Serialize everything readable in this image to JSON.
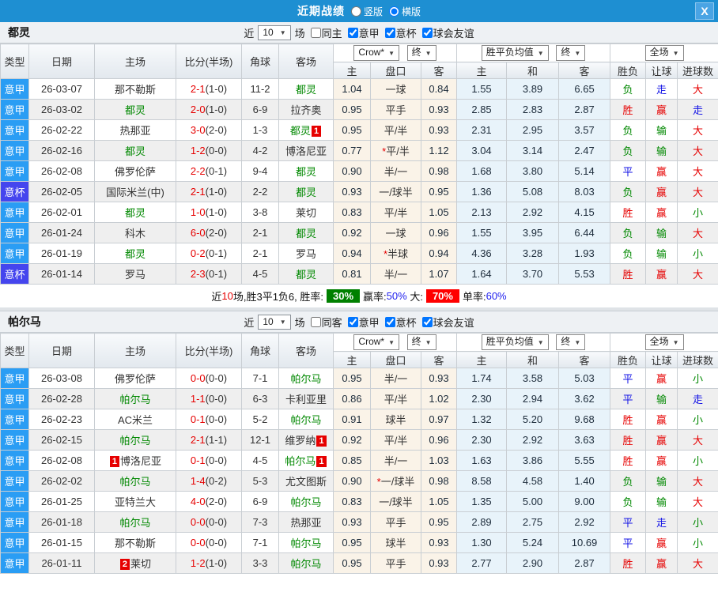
{
  "titlebar": {
    "title": "近期战绩",
    "close": "X",
    "layout": {
      "vertical": {
        "label": "竖版",
        "checked": false
      },
      "horizontal": {
        "label": "横版",
        "checked": true
      }
    }
  },
  "columns": {
    "type": "类型",
    "date": "日期",
    "home": "主场",
    "score": "比分(半场)",
    "corner": "角球",
    "away": "客场",
    "odds_home": "主",
    "handicap": "盘口",
    "odds_away": "客",
    "mean_home": "主",
    "mean_draw": "和",
    "mean_away": "客",
    "result": "胜负",
    "let_goal": "让球",
    "goals": "进球数"
  },
  "dropdowns": {
    "company": "Crow*",
    "final": "终",
    "mean": "胜平负均值",
    "full": "全场",
    "arrow": "▼"
  },
  "colors": {
    "header_blue": "#1e8fd2",
    "serie_a_badge": "#2a9df4",
    "italy_cup_badge": "#4545ee",
    "win_red": "#e60000",
    "loss_green": "#008800",
    "draw_blue": "#1414e6",
    "odds_bg": "#faf3e8",
    "mean_bg": "#e8f3fa"
  },
  "sections": [
    {
      "team": "都灵",
      "filter": {
        "near": "近",
        "count": "10",
        "games": "场",
        "same_label": "同主",
        "same_checked": false,
        "leagues": [
          {
            "label": "意甲",
            "checked": true
          },
          {
            "label": "意杯",
            "checked": true
          },
          {
            "label": "球会友谊",
            "checked": true
          }
        ]
      },
      "rows": [
        {
          "lt": "jia",
          "league": "意甲",
          "date": "26-03-07",
          "home": {
            "t": "那不勒斯"
          },
          "score": "2-1",
          "half": "(1-0)",
          "corner": "11-2",
          "away": {
            "t": "都灵",
            "g": 1
          },
          "o": [
            "1.04",
            "一球",
            "0.84"
          ],
          "star": 0,
          "m": [
            "1.55",
            "3.89",
            "6.65"
          ],
          "res": [
            [
              "负",
              "g"
            ],
            [
              "走",
              "b"
            ],
            [
              "大",
              "r"
            ]
          ]
        },
        {
          "lt": "jia",
          "league": "意甲",
          "date": "26-03-02",
          "home": {
            "t": "都灵",
            "g": 1
          },
          "score": "2-0",
          "half": "(1-0)",
          "corner": "6-9",
          "away": {
            "t": "拉齐奥"
          },
          "o": [
            "0.95",
            "平手",
            "0.93"
          ],
          "star": 0,
          "m": [
            "2.85",
            "2.83",
            "2.87"
          ],
          "res": [
            [
              "胜",
              "r"
            ],
            [
              "赢",
              "r"
            ],
            [
              "走",
              "b"
            ]
          ]
        },
        {
          "lt": "jia",
          "league": "意甲",
          "date": "26-02-22",
          "home": {
            "t": "热那亚"
          },
          "score": "3-0",
          "half": "(2-0)",
          "corner": "1-3",
          "away": {
            "t": "都灵",
            "g": 1,
            "bd": "1",
            "bp": "after"
          },
          "o": [
            "0.95",
            "平/半",
            "0.93"
          ],
          "star": 0,
          "m": [
            "2.31",
            "2.95",
            "3.57"
          ],
          "res": [
            [
              "负",
              "g"
            ],
            [
              "输",
              "g"
            ],
            [
              "大",
              "r"
            ]
          ]
        },
        {
          "lt": "jia",
          "league": "意甲",
          "date": "26-02-16",
          "home": {
            "t": "都灵",
            "g": 1
          },
          "score": "1-2",
          "half": "(0-0)",
          "corner": "4-2",
          "away": {
            "t": "博洛尼亚"
          },
          "o": [
            "0.77",
            "平/半",
            "1.12"
          ],
          "star": 1,
          "m": [
            "3.04",
            "3.14",
            "2.47"
          ],
          "res": [
            [
              "负",
              "g"
            ],
            [
              "输",
              "g"
            ],
            [
              "大",
              "r"
            ]
          ]
        },
        {
          "lt": "jia",
          "league": "意甲",
          "date": "26-02-08",
          "home": {
            "t": "佛罗伦萨"
          },
          "score": "2-2",
          "half": "(0-1)",
          "corner": "9-4",
          "away": {
            "t": "都灵",
            "g": 1
          },
          "o": [
            "0.90",
            "半/一",
            "0.98"
          ],
          "star": 0,
          "m": [
            "1.68",
            "3.80",
            "5.14"
          ],
          "res": [
            [
              "平",
              "b"
            ],
            [
              "赢",
              "r"
            ],
            [
              "大",
              "r"
            ]
          ]
        },
        {
          "lt": "bei",
          "league": "意杯",
          "date": "26-02-05",
          "home": {
            "t": "国际米兰(中)"
          },
          "score": "2-1",
          "half": "(1-0)",
          "corner": "2-2",
          "away": {
            "t": "都灵",
            "g": 1
          },
          "o": [
            "0.93",
            "一/球半",
            "0.95"
          ],
          "star": 0,
          "m": [
            "1.36",
            "5.08",
            "8.03"
          ],
          "res": [
            [
              "负",
              "g"
            ],
            [
              "赢",
              "r"
            ],
            [
              "大",
              "r"
            ]
          ]
        },
        {
          "lt": "jia",
          "league": "意甲",
          "date": "26-02-01",
          "home": {
            "t": "都灵",
            "g": 1
          },
          "score": "1-0",
          "half": "(1-0)",
          "corner": "3-8",
          "away": {
            "t": "莱切"
          },
          "o": [
            "0.83",
            "平/半",
            "1.05"
          ],
          "star": 0,
          "m": [
            "2.13",
            "2.92",
            "4.15"
          ],
          "res": [
            [
              "胜",
              "r"
            ],
            [
              "赢",
              "r"
            ],
            [
              "小",
              "g"
            ]
          ]
        },
        {
          "lt": "jia",
          "league": "意甲",
          "date": "26-01-24",
          "home": {
            "t": "科木"
          },
          "score": "6-0",
          "half": "(2-0)",
          "corner": "2-1",
          "away": {
            "t": "都灵",
            "g": 1
          },
          "o": [
            "0.92",
            "一球",
            "0.96"
          ],
          "star": 0,
          "m": [
            "1.55",
            "3.95",
            "6.44"
          ],
          "res": [
            [
              "负",
              "g"
            ],
            [
              "输",
              "g"
            ],
            [
              "大",
              "r"
            ]
          ]
        },
        {
          "lt": "jia",
          "league": "意甲",
          "date": "26-01-19",
          "home": {
            "t": "都灵",
            "g": 1
          },
          "score": "0-2",
          "half": "(0-1)",
          "corner": "2-1",
          "away": {
            "t": "罗马"
          },
          "o": [
            "0.94",
            "半球",
            "0.94"
          ],
          "star": 1,
          "m": [
            "4.36",
            "3.28",
            "1.93"
          ],
          "res": [
            [
              "负",
              "g"
            ],
            [
              "输",
              "g"
            ],
            [
              "小",
              "g"
            ]
          ]
        },
        {
          "lt": "bei",
          "league": "意杯",
          "date": "26-01-14",
          "home": {
            "t": "罗马"
          },
          "score": "2-3",
          "half": "(0-1)",
          "corner": "4-5",
          "away": {
            "t": "都灵",
            "g": 1
          },
          "o": [
            "0.81",
            "半/一",
            "1.07"
          ],
          "star": 0,
          "m": [
            "1.64",
            "3.70",
            "5.53"
          ],
          "res": [
            [
              "胜",
              "r"
            ],
            [
              "赢",
              "r"
            ],
            [
              "大",
              "r"
            ]
          ]
        }
      ],
      "summary": {
        "p1": "近",
        "count": "10",
        "p2": "场,胜3平1负6, 胜率:",
        "win_rate": "30%",
        "p3": "赢率:",
        "v2": "50%",
        "p4": "大:",
        "v3": "70%",
        "p5": "单率:",
        "v4": "60%"
      }
    },
    {
      "team": "帕尔马",
      "filter": {
        "near": "近",
        "count": "10",
        "games": "场",
        "same_label": "同客",
        "same_checked": false,
        "leagues": [
          {
            "label": "意甲",
            "checked": true
          },
          {
            "label": "意杯",
            "checked": true
          },
          {
            "label": "球会友谊",
            "checked": true
          }
        ]
      },
      "rows": [
        {
          "lt": "jia",
          "league": "意甲",
          "date": "26-03-08",
          "home": {
            "t": "佛罗伦萨"
          },
          "score": "0-0",
          "half": "(0-0)",
          "corner": "7-1",
          "away": {
            "t": "帕尔马",
            "g": 1
          },
          "o": [
            "0.95",
            "半/一",
            "0.93"
          ],
          "star": 0,
          "m": [
            "1.74",
            "3.58",
            "5.03"
          ],
          "res": [
            [
              "平",
              "b"
            ],
            [
              "赢",
              "r"
            ],
            [
              "小",
              "g"
            ]
          ]
        },
        {
          "lt": "jia",
          "league": "意甲",
          "date": "26-02-28",
          "home": {
            "t": "帕尔马",
            "g": 1
          },
          "score": "1-1",
          "half": "(0-0)",
          "corner": "6-3",
          "away": {
            "t": "卡利亚里"
          },
          "o": [
            "0.86",
            "平/半",
            "1.02"
          ],
          "star": 0,
          "m": [
            "2.30",
            "2.94",
            "3.62"
          ],
          "res": [
            [
              "平",
              "b"
            ],
            [
              "输",
              "g"
            ],
            [
              "走",
              "b"
            ]
          ]
        },
        {
          "lt": "jia",
          "league": "意甲",
          "date": "26-02-23",
          "home": {
            "t": "AC米兰"
          },
          "score": "0-1",
          "half": "(0-0)",
          "corner": "5-2",
          "away": {
            "t": "帕尔马",
            "g": 1
          },
          "o": [
            "0.91",
            "球半",
            "0.97"
          ],
          "star": 0,
          "m": [
            "1.32",
            "5.20",
            "9.68"
          ],
          "res": [
            [
              "胜",
              "r"
            ],
            [
              "赢",
              "r"
            ],
            [
              "小",
              "g"
            ]
          ]
        },
        {
          "lt": "jia",
          "league": "意甲",
          "date": "26-02-15",
          "home": {
            "t": "帕尔马",
            "g": 1
          },
          "score": "2-1",
          "half": "(1-1)",
          "corner": "12-1",
          "away": {
            "t": "维罗纳",
            "bd": "1",
            "bp": "after"
          },
          "o": [
            "0.92",
            "平/半",
            "0.96"
          ],
          "star": 0,
          "m": [
            "2.30",
            "2.92",
            "3.63"
          ],
          "res": [
            [
              "胜",
              "r"
            ],
            [
              "赢",
              "r"
            ],
            [
              "大",
              "r"
            ]
          ]
        },
        {
          "lt": "jia",
          "league": "意甲",
          "date": "26-02-08",
          "home": {
            "t": "博洛尼亚",
            "bd": "1",
            "bp": "before"
          },
          "score": "0-1",
          "half": "(0-0)",
          "corner": "4-5",
          "away": {
            "t": "帕尔马",
            "g": 1,
            "bd": "1",
            "bp": "after"
          },
          "o": [
            "0.85",
            "半/一",
            "1.03"
          ],
          "star": 0,
          "m": [
            "1.63",
            "3.86",
            "5.55"
          ],
          "res": [
            [
              "胜",
              "r"
            ],
            [
              "赢",
              "r"
            ],
            [
              "小",
              "g"
            ]
          ]
        },
        {
          "lt": "jia",
          "league": "意甲",
          "date": "26-02-02",
          "home": {
            "t": "帕尔马",
            "g": 1
          },
          "score": "1-4",
          "half": "(0-2)",
          "corner": "5-3",
          "away": {
            "t": "尤文图斯"
          },
          "o": [
            "0.90",
            "一/球半",
            "0.98"
          ],
          "star": 1,
          "m": [
            "8.58",
            "4.58",
            "1.40"
          ],
          "res": [
            [
              "负",
              "g"
            ],
            [
              "输",
              "g"
            ],
            [
              "大",
              "r"
            ]
          ]
        },
        {
          "lt": "jia",
          "league": "意甲",
          "date": "26-01-25",
          "home": {
            "t": "亚特兰大"
          },
          "score": "4-0",
          "half": "(2-0)",
          "corner": "6-9",
          "away": {
            "t": "帕尔马",
            "g": 1
          },
          "o": [
            "0.83",
            "一/球半",
            "1.05"
          ],
          "star": 0,
          "m": [
            "1.35",
            "5.00",
            "9.00"
          ],
          "res": [
            [
              "负",
              "g"
            ],
            [
              "输",
              "g"
            ],
            [
              "大",
              "r"
            ]
          ]
        },
        {
          "lt": "jia",
          "league": "意甲",
          "date": "26-01-18",
          "home": {
            "t": "帕尔马",
            "g": 1
          },
          "score": "0-0",
          "half": "(0-0)",
          "corner": "7-3",
          "away": {
            "t": "热那亚"
          },
          "o": [
            "0.93",
            "平手",
            "0.95"
          ],
          "star": 0,
          "m": [
            "2.89",
            "2.75",
            "2.92"
          ],
          "res": [
            [
              "平",
              "b"
            ],
            [
              "走",
              "b"
            ],
            [
              "小",
              "g"
            ]
          ]
        },
        {
          "lt": "jia",
          "league": "意甲",
          "date": "26-01-15",
          "home": {
            "t": "那不勒斯"
          },
          "score": "0-0",
          "half": "(0-0)",
          "corner": "7-1",
          "away": {
            "t": "帕尔马",
            "g": 1
          },
          "o": [
            "0.95",
            "球半",
            "0.93"
          ],
          "star": 0,
          "m": [
            "1.30",
            "5.24",
            "10.69"
          ],
          "res": [
            [
              "平",
              "b"
            ],
            [
              "赢",
              "r"
            ],
            [
              "小",
              "g"
            ]
          ]
        },
        {
          "lt": "jia",
          "league": "意甲",
          "date": "26-01-11",
          "home": {
            "t": "莱切",
            "bd": "2",
            "bp": "before"
          },
          "score": "1-2",
          "half": "(1-0)",
          "corner": "3-3",
          "away": {
            "t": "帕尔马",
            "g": 1
          },
          "o": [
            "0.95",
            "平手",
            "0.93"
          ],
          "star": 0,
          "m": [
            "2.77",
            "2.90",
            "2.87"
          ],
          "res": [
            [
              "胜",
              "r"
            ],
            [
              "赢",
              "r"
            ],
            [
              "大",
              "r"
            ]
          ]
        }
      ]
    }
  ]
}
